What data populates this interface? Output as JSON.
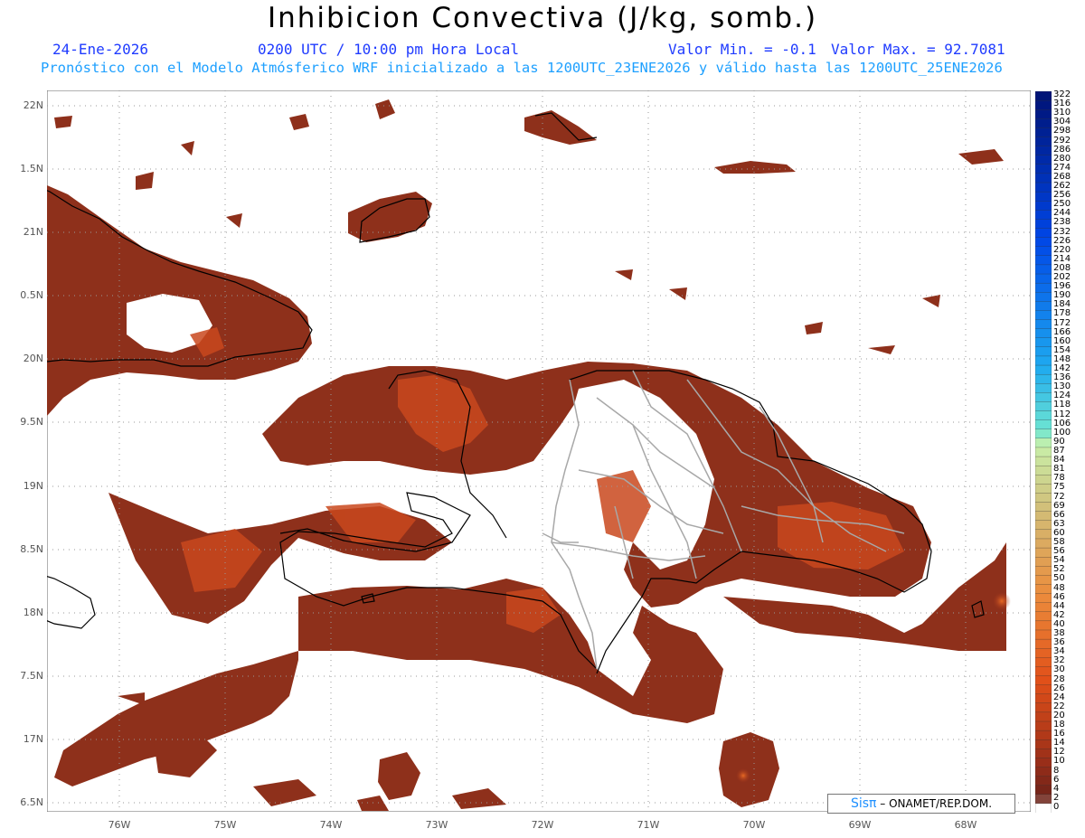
{
  "header": {
    "title": "Inhibicion Convectiva (J/kg, somb.)",
    "date": "24-Ene-2026",
    "time": "0200 UTC / 10:00 pm Hora Local",
    "min_label": "Valor Min. = -0.1",
    "max_label": "Valor Max. = 92.7081",
    "model_line": "Pronóstico con el Modelo Atmósferico WRF inicializado a las 1200UTC_23ENE2026 y válido hasta las  1200UTC_25ENE2026"
  },
  "axes": {
    "y_ticks": [
      "22N",
      "1.5N",
      "21N",
      "0.5N",
      "20N",
      "9.5N",
      "19N",
      "8.5N",
      "18N",
      "7.5N",
      "17N",
      "6.5N"
    ],
    "x_ticks": [
      "76W",
      "75W",
      "74W",
      "73W",
      "72W",
      "71W",
      "70W",
      "69W",
      "68W"
    ]
  },
  "legend": {
    "levels": [
      "322",
      "316",
      "310",
      "304",
      "298",
      "292",
      "286",
      "280",
      "274",
      "268",
      "262",
      "256",
      "250",
      "244",
      "238",
      "232",
      "226",
      "220",
      "214",
      "208",
      "202",
      "196",
      "190",
      "184",
      "178",
      "172",
      "166",
      "160",
      "154",
      "148",
      "142",
      "136",
      "130",
      "124",
      "118",
      "112",
      "106",
      "100",
      "90",
      "87",
      "84",
      "81",
      "78",
      "75",
      "72",
      "69",
      "66",
      "63",
      "60",
      "58",
      "56",
      "54",
      "52",
      "50",
      "48",
      "46",
      "44",
      "42",
      "40",
      "38",
      "36",
      "34",
      "32",
      "30",
      "28",
      "26",
      "24",
      "22",
      "20",
      "18",
      "16",
      "14",
      "12",
      "10",
      "8",
      "6",
      "4",
      "2",
      "0"
    ]
  },
  "credit": {
    "brand": "Sisπ",
    "text": " – ONAMET/REP.DOM."
  },
  "colors": {
    "field_dark": "#7a2a1a",
    "field_mid": "#a3361c",
    "field_bright": "#e05a1e",
    "coast": "#000000",
    "provinces": "#a8a8a8"
  }
}
